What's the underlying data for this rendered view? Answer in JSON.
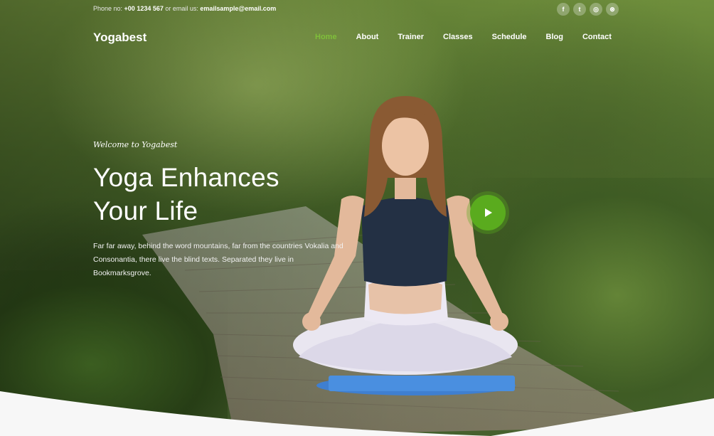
{
  "topbar": {
    "phone_label": "Phone no: ",
    "phone": "+00 1234 567",
    "email_label": " or email us: ",
    "email": "emailsample@email.com"
  },
  "socials": [
    {
      "icon": "facebook-icon",
      "glyph": "f"
    },
    {
      "icon": "twitter-icon",
      "glyph": "t"
    },
    {
      "icon": "instagram-icon",
      "glyph": "◎"
    },
    {
      "icon": "dribbble-icon",
      "glyph": "⊛"
    }
  ],
  "brand": "Yogabest",
  "nav": [
    "Home",
    "About",
    "Trainer",
    "Classes",
    "Schedule",
    "Blog",
    "Contact"
  ],
  "hero": {
    "welcome": "Welcome to Yogabest",
    "title_line1": "Yoga Enhances",
    "title_line2": "Your Life",
    "description": "Far far away, behind the word mountains, far from the countries Vokalia and Consonantia, there live the blind texts. Separated they live in Bookmarksgrove."
  },
  "colors": {
    "accent": "#7fbf3a",
    "play_button": "#5aab1e"
  }
}
